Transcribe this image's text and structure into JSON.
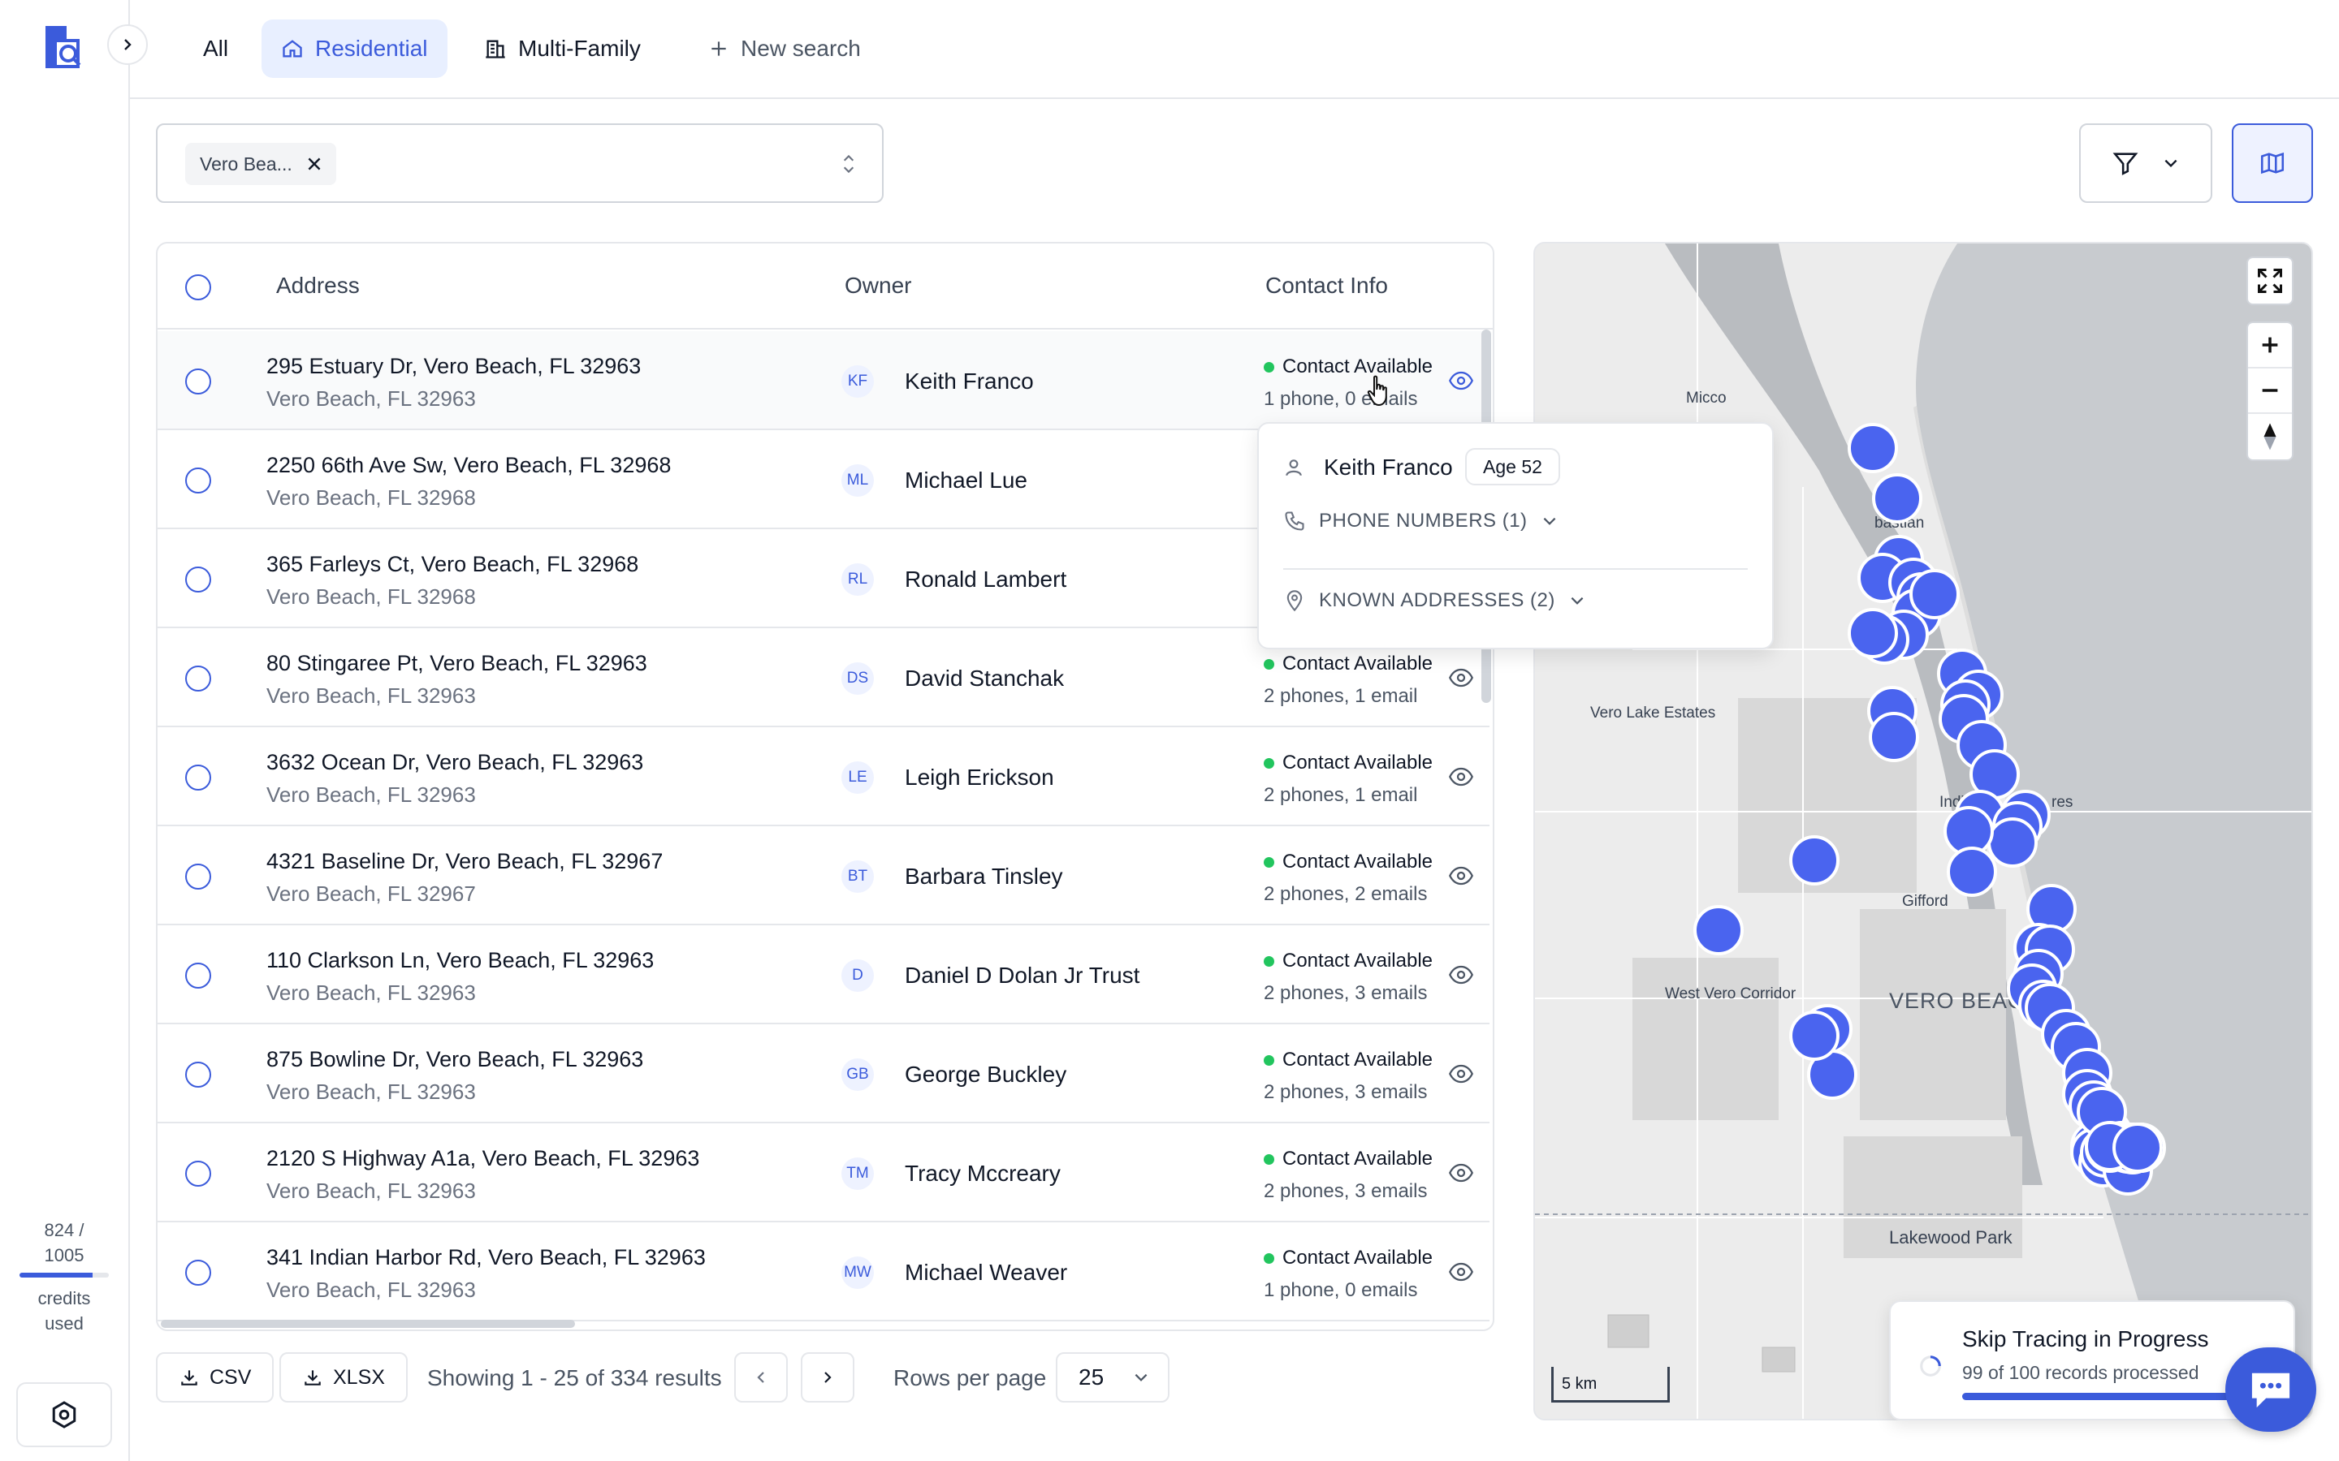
{
  "app": {
    "name": "Property search"
  },
  "tabs": [
    {
      "label": "All",
      "icon": "none"
    },
    {
      "label": "Residential",
      "icon": "home-icon",
      "active": true
    },
    {
      "label": "Multi-Family",
      "icon": "building-icon"
    },
    {
      "label": "New search",
      "icon": "plus-icon"
    }
  ],
  "search": {
    "chip_label": "Vero Bea..."
  },
  "table": {
    "columns": {
      "address": "Address",
      "owner": "Owner",
      "contact": "Contact Info"
    },
    "rows": [
      {
        "address": "295 Estuary Dr, Vero Beach, FL 32963",
        "city": "Vero Beach, FL 32963",
        "initials": "KF",
        "owner": "Keith Franco",
        "status": "Contact Available",
        "details": "1 phone, 0 emails"
      },
      {
        "address": "2250 66th Ave Sw, Vero Beach, FL 32968",
        "city": "Vero Beach, FL 32968",
        "initials": "ML",
        "owner": "Michael Lue",
        "status": "",
        "details": ""
      },
      {
        "address": "365 Farleys Ct, Vero Beach, FL 32968",
        "city": "Vero Beach, FL 32968",
        "initials": "RL",
        "owner": "Ronald Lambert",
        "status": "",
        "details": ""
      },
      {
        "address": "80 Stingaree Pt, Vero Beach, FL 32963",
        "city": "Vero Beach, FL 32963",
        "initials": "DS",
        "owner": "David Stanchak",
        "status": "Contact Available",
        "details": "2 phones, 1 email"
      },
      {
        "address": "3632 Ocean Dr, Vero Beach, FL 32963",
        "city": "Vero Beach, FL 32963",
        "initials": "LE",
        "owner": "Leigh Erickson",
        "status": "Contact Available",
        "details": "2 phones, 1 email"
      },
      {
        "address": "4321 Baseline Dr, Vero Beach, FL 32967",
        "city": "Vero Beach, FL 32967",
        "initials": "BT",
        "owner": "Barbara Tinsley",
        "status": "Contact Available",
        "details": "2 phones, 2 emails"
      },
      {
        "address": "110 Clarkson Ln, Vero Beach, FL 32963",
        "city": "Vero Beach, FL 32963",
        "initials": "D",
        "owner": "Daniel D Dolan Jr Trust",
        "status": "Contact Available",
        "details": "2 phones, 3 emails"
      },
      {
        "address": "875 Bowline Dr, Vero Beach, FL 32963",
        "city": "Vero Beach, FL 32963",
        "initials": "GB",
        "owner": "George Buckley",
        "status": "Contact Available",
        "details": "2 phones, 3 emails"
      },
      {
        "address": "2120 S Highway A1a, Vero Beach, FL 32963",
        "city": "Vero Beach, FL 32963",
        "initials": "TM",
        "owner": "Tracy Mccreary",
        "status": "Contact Available",
        "details": "2 phones, 3 emails"
      },
      {
        "address": "341 Indian Harbor Rd, Vero Beach, FL 32963",
        "city": "Vero Beach, FL 32963",
        "initials": "MW",
        "owner": "Michael Weaver",
        "status": "Contact Available",
        "details": "1 phone, 0 emails"
      }
    ]
  },
  "popover": {
    "name": "Keith Franco",
    "age": "Age 52",
    "phones_label": "PHONE NUMBERS (1)",
    "addresses_label": "KNOWN ADDRESSES (2)"
  },
  "footer": {
    "csv_label": "CSV",
    "xlsx_label": "XLSX",
    "showing": "Showing 1 - 25 of 334 results",
    "rows_per_page_label": "Rows per page",
    "rows_per_page_value": "25"
  },
  "credits": {
    "used": "824 /",
    "total": "1005",
    "label_1": "credits",
    "label_2": "used",
    "fraction": 0.82
  },
  "map": {
    "labels": {
      "micco": "Micco",
      "sebastian": "bastian",
      "vero_lake_estates": "Vero Lake Estates",
      "indian_river_shores_a": "Indi",
      "indian_river_shores_b": "res",
      "gifford": "Gifford",
      "west_vero_corridor": "West Vero Corridor",
      "vero_beach": "VERO BEACH",
      "lakewood_park": "Lakewood Park"
    },
    "scale": "5 km"
  },
  "toast": {
    "title": "Skip Tracing in Progress",
    "subtitle": "99 of 100 records processed",
    "progress": 0.99
  },
  "colors": {
    "accent": "#3b5bdb",
    "success": "#22c55e",
    "marker": "#4a64ef"
  }
}
